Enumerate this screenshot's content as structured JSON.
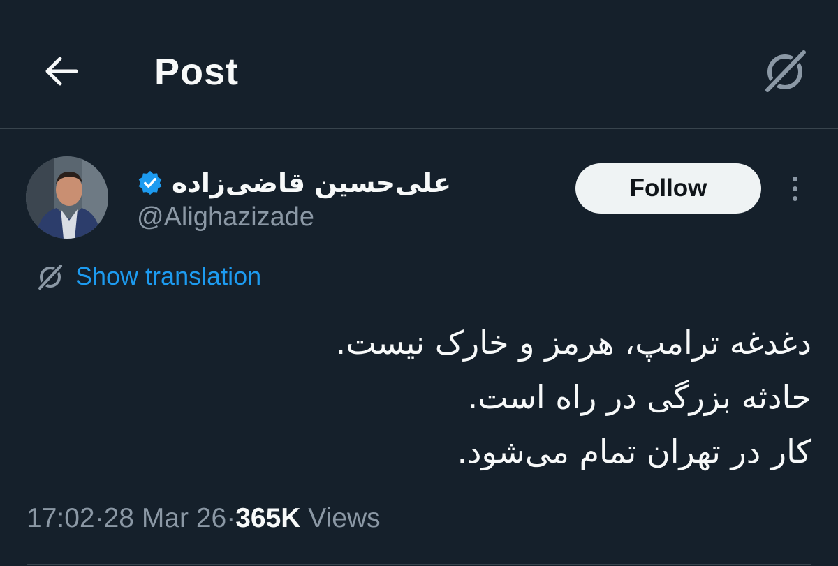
{
  "header": {
    "title": "Post",
    "back_icon": "arrow-left-icon",
    "right_icon": "grok-icon"
  },
  "author": {
    "display_name": "علی‌حسین قاضی‌زاده",
    "handle": "@Alighazizade",
    "verified": true,
    "verified_color": "#1d9bf0",
    "avatar_icon": "user-avatar"
  },
  "actions": {
    "follow_label": "Follow",
    "more_icon": "more-vertical-icon"
  },
  "translation": {
    "label": "Show translation",
    "icon": "translate-icon"
  },
  "tweet": {
    "lines": [
      "دغدغه ترامپ، هرمز و خارک نیست.",
      "حادثه بزرگی در راه است.",
      "کار در تهران تمام می‌شود."
    ]
  },
  "meta": {
    "time": "17:02",
    "separator": " · ",
    "date": "28 Mar 26",
    "views_count": "365K",
    "views_label": "Views"
  },
  "colors": {
    "background": "#15202b",
    "accent": "#1d9bf0",
    "muted": "#8b98a5",
    "divider": "#38444d"
  }
}
